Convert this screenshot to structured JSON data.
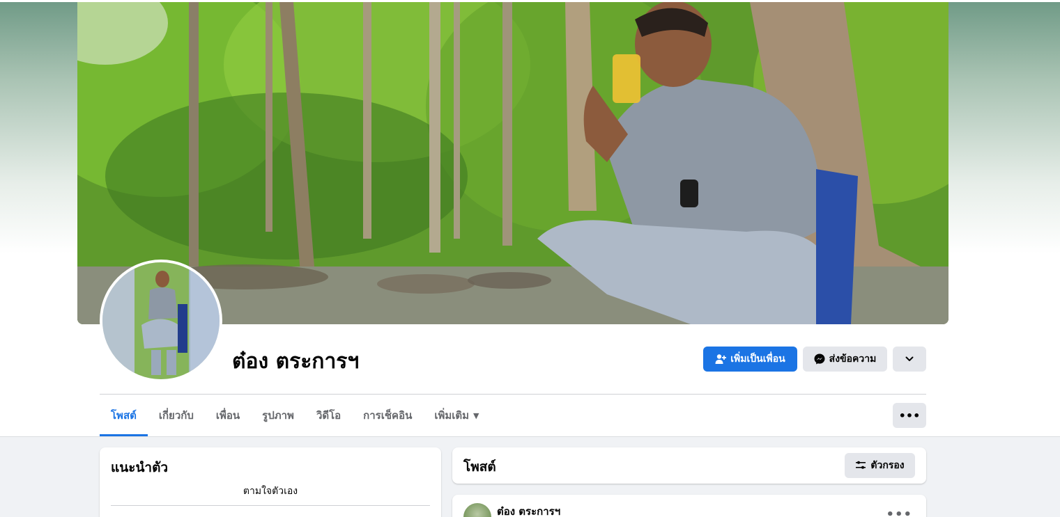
{
  "profile": {
    "name": "ต๋อง ตระการฯ"
  },
  "actions": {
    "add_friend_label": "เพิ่มเป็นเพื่อน",
    "message_label": "ส่งข้อความ"
  },
  "tabs": [
    {
      "label": "โพสต์",
      "active": true
    },
    {
      "label": "เกี่ยวกับ",
      "active": false
    },
    {
      "label": "เพื่อน",
      "active": false
    },
    {
      "label": "รูปภาพ",
      "active": false
    },
    {
      "label": "วิดีโอ",
      "active": false
    },
    {
      "label": "การเช็คอิน",
      "active": false
    },
    {
      "label": "เพิ่มเติม",
      "active": false
    }
  ],
  "intro": {
    "title": "แนะนำตัว",
    "bio": "ตามใจตัวเอง"
  },
  "posts": {
    "title": "โพสต์",
    "filter_label": "ตัวกรอง",
    "first_post_author": "ต๋อง ตระการฯ"
  },
  "colors": {
    "accent": "#1b74e4",
    "secondary_button": "#e4e6eb",
    "page_background": "#f0f2f5"
  },
  "icons": {
    "add_friend": "person-plus-icon",
    "message": "messenger-icon",
    "chevron": "chevron-down-icon",
    "more": "ellipsis-icon",
    "filter": "sliders-icon"
  }
}
